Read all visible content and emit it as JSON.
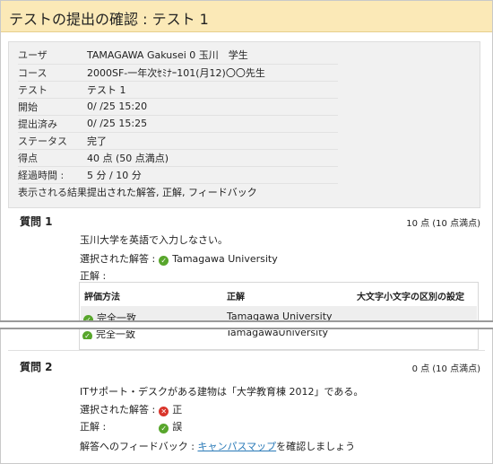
{
  "page": {
    "title": "テストの提出の確認 : テスト 1"
  },
  "summary": {
    "rows": [
      {
        "label": "ユーザ",
        "value": "TAMAGAWA Gakusei 0   玉川　学生"
      },
      {
        "label": "コース",
        "value": "2000SF-一年次ｾﾐﾅｰ101(月12)〇〇先生"
      },
      {
        "label": "テスト",
        "value": "テスト 1"
      },
      {
        "label": "開始",
        "value": "0/   /25 15:20"
      },
      {
        "label": "提出済み",
        "value": "0/   /25 15:25"
      },
      {
        "label": "ステータス",
        "value": "完了"
      },
      {
        "label": "得点",
        "value": "40 点 (50 点満点)"
      },
      {
        "label": "経過時間 :",
        "value": "5 分 / 10 分"
      },
      {
        "label": "表示される結果",
        "value": "提出された解答, 正解, フィードバック"
      }
    ]
  },
  "q1": {
    "heading": "質問 1",
    "points": "10 点 (10 点満点)",
    "text": "玉川大学を英語で入力しなさい。",
    "selected_label": "選択された解答 :",
    "selected_value": "Tamagawa University",
    "correct_label": "正解 :",
    "eval": {
      "col_method": "評価方法",
      "col_correct": "正解",
      "col_case": "大文字小文字の区別の設定",
      "row1_method": "完全一致",
      "row1_answer": "Tamagawa University",
      "row2_method": "完全一致",
      "row2_answer": "TamagawaUniversity"
    }
  },
  "q2": {
    "heading": "質問 2",
    "points": "0 点 (10 点満点)",
    "text": "ITサポート・デスクがある建物は「大学教育棟 2012」である。",
    "selected_label": "選択された解答 :",
    "selected_value": "正",
    "correct_label": "正解 :",
    "correct_value": "誤",
    "feedback_label": "解答へのフィードバック :",
    "feedback_link": "キャンパスマップ",
    "feedback_suffix": "を確認しましょう"
  },
  "colors": {
    "title_bg": "#fbe9b7",
    "ok": "#58a62c",
    "ng": "#d9352b",
    "link": "#2a7ab8"
  }
}
